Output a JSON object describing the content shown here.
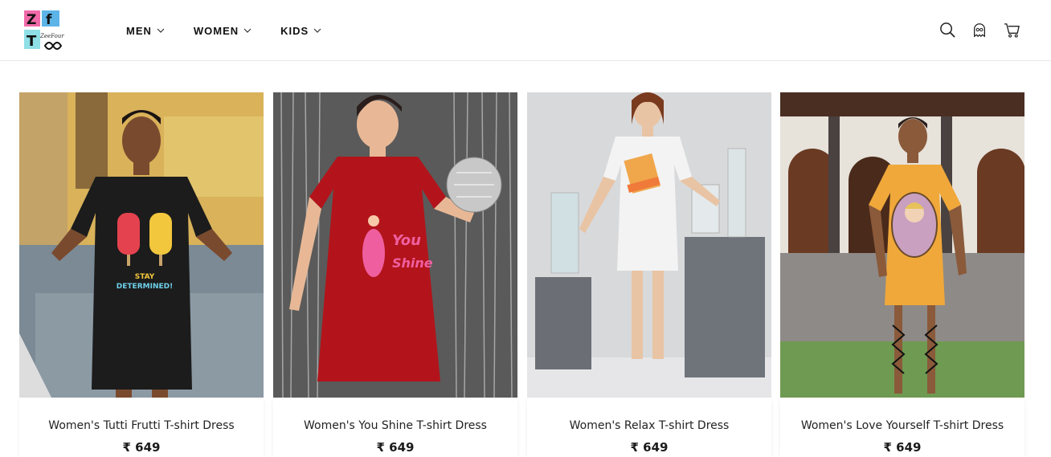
{
  "header": {
    "logo": {
      "letters": [
        "Z",
        "f",
        "T"
      ],
      "script": "ZeeFourTee"
    },
    "nav": [
      {
        "label": "MEN"
      },
      {
        "label": "WOMEN"
      },
      {
        "label": "KIDS"
      }
    ],
    "icons": [
      "search-icon",
      "account-icon",
      "cart-icon"
    ]
  },
  "products": [
    {
      "title": "Women's Tutti Frutti T-shirt Dress",
      "price": "₹ 649",
      "dress_color": "#1c1c1c"
    },
    {
      "title": "Women's You Shine T-shirt Dress",
      "price": "₹ 649",
      "dress_color": "#b3141b"
    },
    {
      "title": "Women's Relax T-shirt Dress",
      "price": "₹ 649",
      "dress_color": "#f3f3f3"
    },
    {
      "title": "Women's Love Yourself T-shirt Dress",
      "price": "₹ 649",
      "dress_color": "#f0a83a"
    }
  ]
}
